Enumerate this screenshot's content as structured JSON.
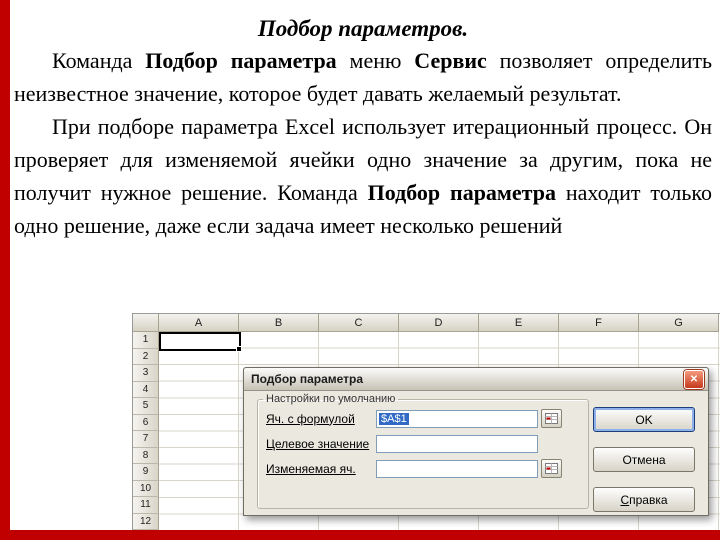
{
  "slide": {
    "title": "Подбор параметров.",
    "paragraph1": {
      "part1": "Команда ",
      "bold1": "Подбор параметра",
      "part2": " меню ",
      "bold2": "Сервис",
      "part3": " позволяет определить неизвестное значение, которое будет давать желаемый результат."
    },
    "paragraph2": {
      "part1": "При подборе параметра Excel использует итерационный процесс. Он проверяет для изменяемой ячейки одно значение за другим, пока не получит нужное решение. Команда ",
      "bold1": "Подбор параметра",
      "part2": " находит только одно решение, даже если задача имеет несколько решений"
    }
  },
  "spreadsheet": {
    "columns": [
      "A",
      "B",
      "C",
      "D",
      "E",
      "F",
      "G"
    ],
    "rows": [
      "1",
      "2",
      "3",
      "4",
      "5",
      "6",
      "7",
      "8",
      "9",
      "10",
      "11",
      "12"
    ],
    "selected_cell": "A1"
  },
  "dialog": {
    "title": "Подбор параметра",
    "close_glyph": "✕",
    "group_label": "Настройки по умолчанию",
    "fields": [
      {
        "label": "Яч. с формулой",
        "value": "$A$1"
      },
      {
        "label": "Целевое значение",
        "value": ""
      },
      {
        "label": "Изменяемая яч.",
        "value": ""
      }
    ],
    "buttons": {
      "ok": "OK",
      "cancel": "Отмена",
      "help_underline": "С",
      "help_rest": "правка"
    }
  },
  "colors": {
    "accent_red": "#c00000",
    "selection_blue": "#316ac5",
    "close_button_red": "#c63a1c",
    "input_border_blue": "#7f9db9"
  }
}
